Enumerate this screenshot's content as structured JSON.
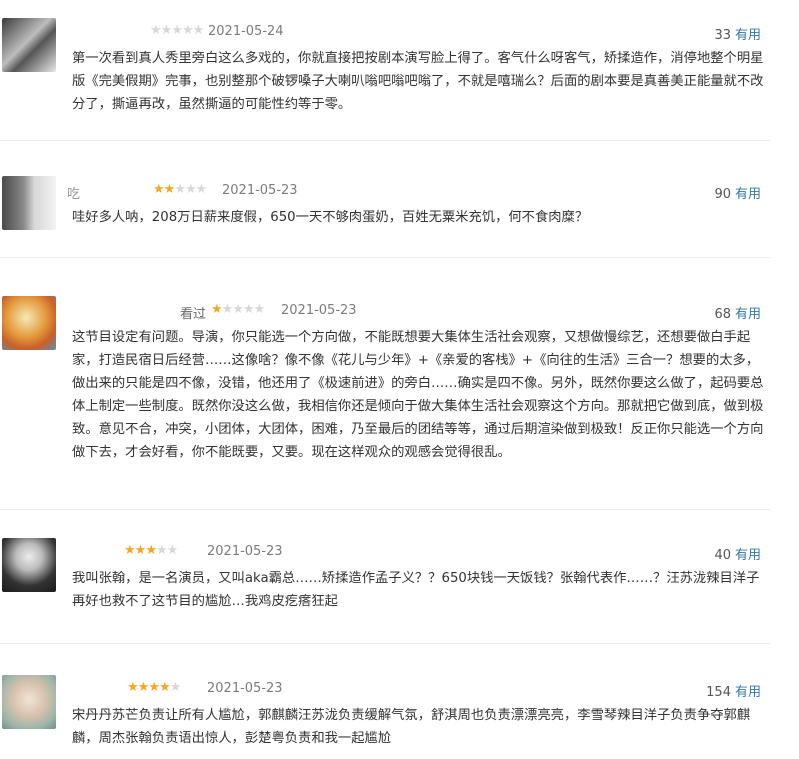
{
  "reviews": [
    {
      "user": "",
      "status": "",
      "rating": 0,
      "date": "2021-05-24",
      "votes": "33",
      "useful_label": "有用",
      "content": "第一次看到真人秀里旁白这么多戏的，你就直接把按剧本演写脸上得了。客气什么呀客气，矫揉造作，消停地整个明星版《完美假期》完事，也别整那个破锣嗓子大喇叭嗡吧嗡吧嗡了，不就是嘻瑞么？后面的剧本要是真善美正能量就不改分了，撕逼再改，虽然撕逼的可能性约等于零。"
    },
    {
      "user": "吃",
      "status": "",
      "rating": 2,
      "date": "2021-05-23",
      "votes": "90",
      "useful_label": "有用",
      "content": "哇好多人呐，208万日薪来度假，650一天不够肉蛋奶，百姓无粟米充饥，何不食肉糜？"
    },
    {
      "user": "",
      "status": "看过",
      "rating": 1,
      "date": "2021-05-23",
      "votes": "68",
      "useful_label": "有用",
      "content": "这节目设定有问题。导演，你只能选一个方向做，不能既想要大集体生活社会观察，又想做慢综艺，还想要做白手起家，打造民宿日后经营……这像啥？像不像《花儿与少年》+《亲爱的客栈》+《向往的生活》三合一？想要的太多，做出来的只能是四不像，没错，他还用了《极速前进》的旁白……确实是四不像。另外，既然你要这么做了，起码要总体上制定一些制度。既然你没这么做，我相信你还是倾向于做大集体生活社会观察这个方向。那就把它做到底，做到极致。意见不合，冲突，小团体，大团体，困难，乃至最后的团结等等，通过后期渲染做到极致！反正你只能选一个方向做下去，才会好看，你不能既要，又要。现在这样观众的观感会觉得很乱。"
    },
    {
      "user": "",
      "status": "",
      "rating": 3,
      "date": "2021-05-23",
      "votes": "40",
      "useful_label": "有用",
      "content": "我叫张翰，是一名演员，又叫aka霸总……矫揉造作孟子义？？650块钱一天饭钱？张翰代表作……？汪苏泷辣目洋子再好也救不了这节目的尴尬…我鸡皮疙瘩狂起"
    },
    {
      "user": "",
      "status": "",
      "rating": 4,
      "date": "2021-05-23",
      "votes": "154",
      "useful_label": "有用",
      "content": "宋丹丹苏芒负责让所有人尴尬，郭麒麟汪苏泷负责缓解气氛，舒淇周也负责漂漂亮亮，李雪琴辣目洋子负责争夺郭麒麟，周杰张翰负责语出惊人，彭楚粤负责和我一起尴尬"
    }
  ],
  "icons": {
    "star": "star-icon",
    "avatar": "avatar-image"
  },
  "colors": {
    "star_on": "#f5a623",
    "star_off": "#d8d8d8",
    "useful": "#3377aa"
  }
}
